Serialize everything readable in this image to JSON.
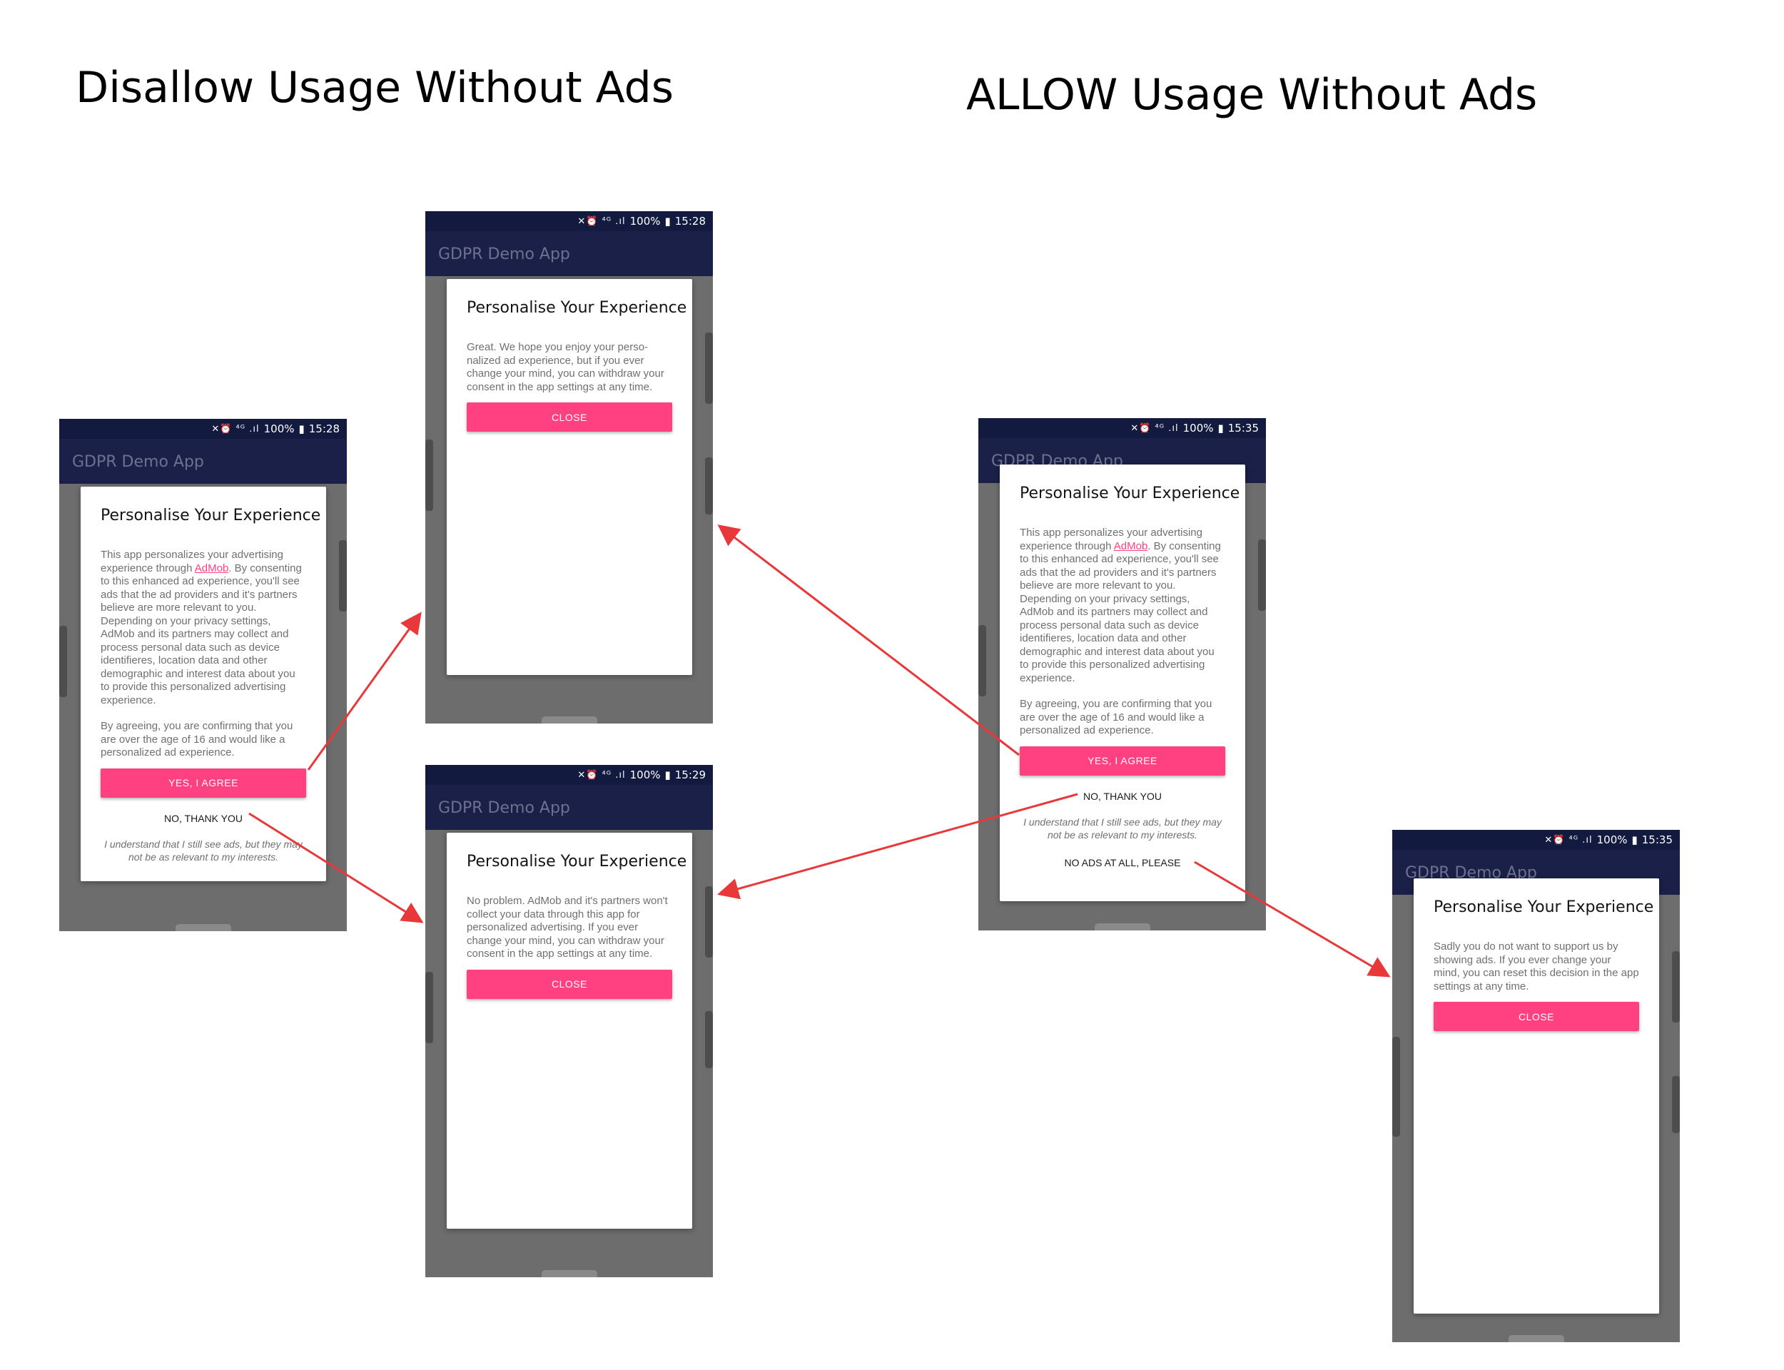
{
  "headings": {
    "disallow": "Disallow Usage Without Ads",
    "allow": "ALLOW Usage Without Ads"
  },
  "app_title": "GDPR Demo App",
  "status_icons": "✕⏰ ⁴ᴳ .ıl",
  "dialog_title": "Personalise Your Experience",
  "consent": {
    "intro_before_link": "This app personalizes your advertising experience through ",
    "link": "AdMob",
    "intro_after_link": ". By consenting to this enhanced ad experience, you'll see ads that the ad providers and it's partners believe are more relevant to you. Depending on your privacy settings, AdMob and its partners may collect and process personal data such as device identifieres, location data and other demographic and interest data about you to provide this personalized advertising experience.",
    "age_text": "By agreeing, you are confirming that you are over the age of 16 and would like a personalized ad experience.",
    "yes_label": "YES, I AGREE",
    "no_label": "NO, THANK YOU",
    "hint": "I understand that I still see ads, but they may not be as relevant to my interests.",
    "no_ads_label": "NO ADS AT ALL, PLEASE"
  },
  "phones": {
    "p1": {
      "time": "15:28",
      "battery": "100%"
    },
    "p2": {
      "time": "15:28",
      "battery": "100%",
      "message": "Great. We hope you enjoy your perso-nalized ad experience, but if you ever change your mind, you can withdraw your consent in the app settings at any time.",
      "close_label": "CLOSE"
    },
    "p3": {
      "time": "15:29",
      "battery": "100%",
      "message": "No problem. AdMob and it's partners won't collect your data through this app for personalized advertising. If you ever change your mind, you can withdraw your consent in the app settings at any time.",
      "close_label": "CLOSE"
    },
    "p4": {
      "time": "15:35",
      "battery": "100%"
    },
    "p5": {
      "time": "15:35",
      "battery": "100%",
      "message": "Sadly you do not want to support us by showing ads. If you ever change your mind, you can reset this decision in the app settings at any time.",
      "close_label": "CLOSE"
    }
  },
  "colors": {
    "accent": "#ff4081",
    "appbar": "#1a2047",
    "statusbar": "#131a40",
    "arrow": "#e8383a"
  }
}
